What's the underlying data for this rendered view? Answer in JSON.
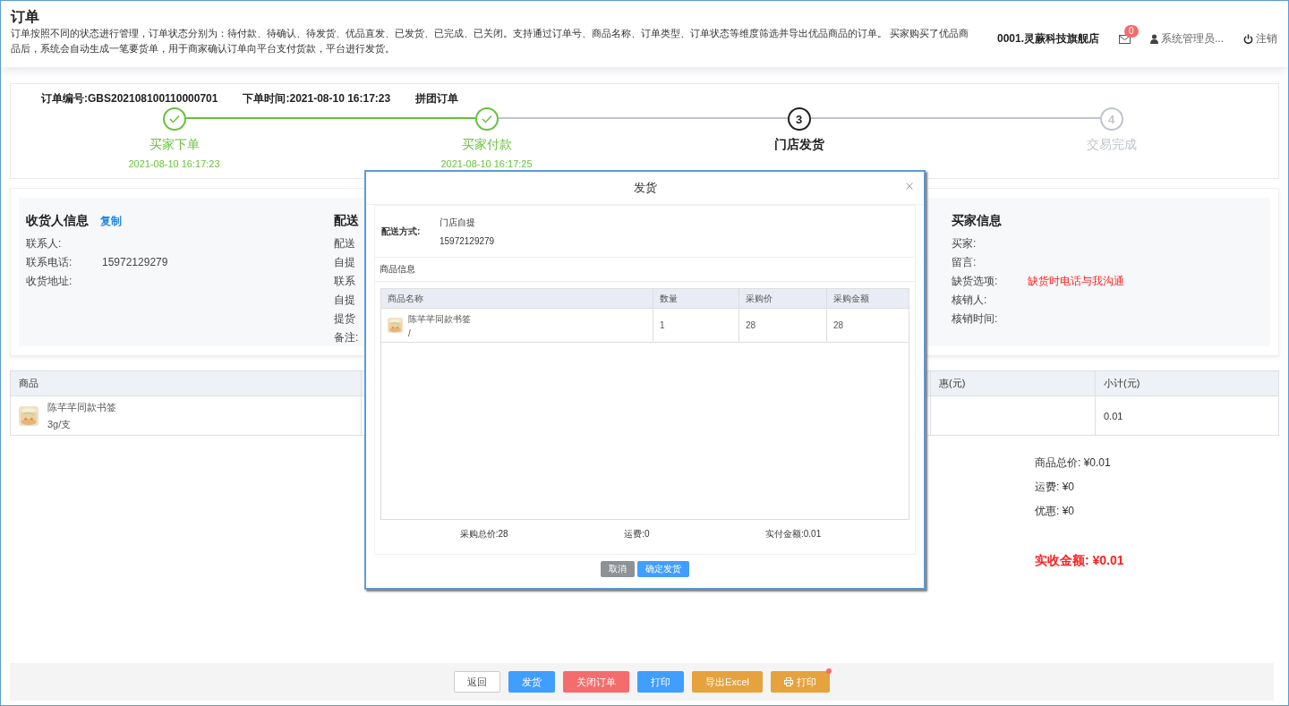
{
  "header": {
    "title": "订单",
    "description": "订单按照不同的状态进行管理，订单状态分别为：待付款、待确认、待发货、优品直发、已发货、已完成、已关闭。支持通过订单号、商品名称、订单类型、订单状态等维度筛选并导出优品商品的订单。 买家购买了优品商品后，系统会自动生成一笔要货单，用于商家确认订单向平台支付货款，平台进行发货。",
    "shop": "0001.灵蕨科技旗舰店",
    "message_count": "0",
    "user": "系统管理员...",
    "logout": "注销"
  },
  "order": {
    "number": "订单编号:GBS202108100110000701",
    "time": "下单时间:2021-08-10 16:17:23",
    "type": "拼团订单"
  },
  "steps": [
    {
      "label": "买家下单",
      "time": "2021-08-10 16:17:23",
      "done": true,
      "current": false
    },
    {
      "label": "买家付款",
      "time": "2021-08-10 16:17:25",
      "done": true,
      "current": false
    },
    {
      "number": "3",
      "label": "门店发货",
      "done": false,
      "current": true
    },
    {
      "number": "4",
      "label": "交易完成",
      "done": false,
      "current": false
    }
  ],
  "info_sections": [
    {
      "title": "收货人信息",
      "action": "复制",
      "rows": [
        {
          "label": "联系人:"
        },
        {
          "label": "联系电话:",
          "value": "15972129279"
        },
        {
          "label": "收货地址:"
        }
      ]
    },
    {
      "title": "配送",
      "rows": [
        {
          "label": "配送"
        },
        {
          "label": "自提"
        },
        {
          "label": "联系"
        },
        {
          "label": "自提"
        },
        {
          "label": "提货"
        },
        {
          "label": "备注:"
        }
      ]
    },
    {
      "title": "买家信息",
      "rows": [
        {
          "label": "买家:"
        },
        {
          "label": "留言:"
        },
        {
          "label": "缺货选项:",
          "value": "缺货时电话与我沟通",
          "kind": "alert"
        },
        {
          "label": "核销人:"
        },
        {
          "label": "核销时间:"
        }
      ]
    }
  ],
  "goods_table": {
    "columns": [
      "商品",
      "惠(元)",
      "小计(元)"
    ],
    "rows": [
      {
        "name": "陈芊芊同款书签",
        "spec": "3g/支",
        "subtotal": "0.01"
      }
    ]
  },
  "summary": [
    "商品总价: ¥0.01",
    "运费: ¥0",
    "优惠: ¥0"
  ],
  "total": "实收金额: ¥0.01",
  "actions": [
    {
      "label": "返回",
      "kind": "default",
      "notify": false
    },
    {
      "label": "发货",
      "kind": "primary",
      "notify": false
    },
    {
      "label": "关闭订单",
      "kind": "danger",
      "notify": false
    },
    {
      "label": "打印",
      "kind": "primary",
      "notify": false
    },
    {
      "label": "导出Excel",
      "kind": "warning",
      "notify": false
    },
    {
      "label": "打印",
      "kind": "print",
      "notify": true
    }
  ],
  "dialog": {
    "title": "发货",
    "delivery_label": "配送方式:",
    "delivery_values": [
      "门店自提",
      "15972129279"
    ],
    "section_title": "商品信息",
    "columns": [
      "商品名称",
      "数量",
      "采购价",
      "采购金额"
    ],
    "rows": [
      {
        "name": "陈芊芊同款书签",
        "spec": "/",
        "quantity": "1",
        "price": "28",
        "amount": "28"
      }
    ],
    "totals": [
      "采购总价:28",
      "运费:0",
      "实付金额:0.01"
    ],
    "buttons": [
      {
        "label": "取消",
        "kind": "secondary"
      },
      {
        "label": "确定发货",
        "kind": "primary"
      }
    ]
  }
}
